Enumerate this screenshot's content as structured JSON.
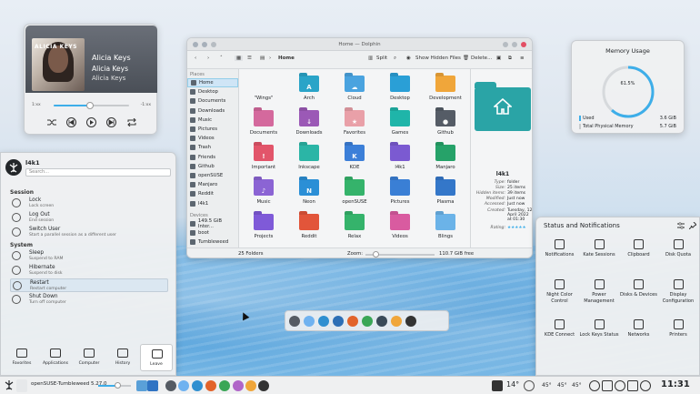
{
  "media": {
    "cover_text": "ALICIA KEYS",
    "title": "Alicia Keys",
    "artist": "Alicia Keys",
    "album": "Alicia Keys",
    "time_elapsed": "1:xx",
    "time_remaining": "-1:xx",
    "progress_fraction": 0.48
  },
  "dolphin": {
    "window_title": "Home — Dolphin",
    "breadcrumb": "Home",
    "toolbar": {
      "split": "Split",
      "show_hidden": "Show Hidden Files",
      "delete": "Delete..."
    },
    "places_header": "Places",
    "places": [
      "Home",
      "Desktop",
      "Documents",
      "Downloads",
      "Music",
      "Pictures",
      "Videos",
      "Trash",
      "Friends",
      "Github",
      "openSUSE",
      "Manjaro",
      "Reddit",
      "l4k1"
    ],
    "devices_header": "Devices",
    "devices": [
      "149.5 GiB Inter...",
      "boot",
      "Tumbleweed"
    ],
    "folders": [
      {
        "name": "\"Wings\"",
        "color": "#ffffff",
        "glyph": ""
      },
      {
        "name": "Arch",
        "color": "#2aa4c8",
        "glyph": "A"
      },
      {
        "name": "Cloud",
        "color": "#4aa3df",
        "glyph": "☁"
      },
      {
        "name": "Desktop",
        "color": "#2a9fd6",
        "glyph": ""
      },
      {
        "name": "Development",
        "color": "#f0a63a",
        "glyph": ""
      },
      {
        "name": "Documents",
        "color": "#d4699d",
        "glyph": ""
      },
      {
        "name": "Downloads",
        "color": "#9b59b6",
        "glyph": "↓"
      },
      {
        "name": "Favorites",
        "color": "#e9a0a8",
        "glyph": "★"
      },
      {
        "name": "Games",
        "color": "#1fb5a9",
        "glyph": ""
      },
      {
        "name": "Github",
        "color": "#555c66",
        "glyph": "●"
      },
      {
        "name": "Important",
        "color": "#e2556a",
        "glyph": "!"
      },
      {
        "name": "Inkscape",
        "color": "#2bb5a6",
        "glyph": ""
      },
      {
        "name": "KDE",
        "color": "#3c7fd8",
        "glyph": "K"
      },
      {
        "name": "l4k1",
        "color": "#7b5ad1",
        "glyph": ""
      },
      {
        "name": "Manjaro",
        "color": "#26a269",
        "glyph": ""
      },
      {
        "name": "Music",
        "color": "#8b64d4",
        "glyph": "♪"
      },
      {
        "name": "Neon",
        "color": "#2b8fd6",
        "glyph": "N"
      },
      {
        "name": "openSUSE",
        "color": "#35b36b",
        "glyph": ""
      },
      {
        "name": "Pictures",
        "color": "#3a7fd5",
        "glyph": ""
      },
      {
        "name": "Plasma",
        "color": "#3477c9",
        "glyph": ""
      },
      {
        "name": "Projects",
        "color": "#7f5ad8",
        "glyph": ""
      },
      {
        "name": "Reddit",
        "color": "#e2553a",
        "glyph": ""
      },
      {
        "name": "Relax",
        "color": "#35b36b",
        "glyph": ""
      },
      {
        "name": "Videos",
        "color": "#d95ba0",
        "glyph": ""
      },
      {
        "name": "Blings",
        "color": "#6bb3e8",
        "glyph": ""
      }
    ],
    "info": {
      "name": "l4k1",
      "fields": [
        {
          "k": "Type:",
          "v": "folder"
        },
        {
          "k": "Size:",
          "v": "25 items"
        },
        {
          "k": "Hidden items:",
          "v": "39 items"
        },
        {
          "k": "Modified:",
          "v": "Just now"
        },
        {
          "k": "Accessed:",
          "v": "Just now"
        },
        {
          "k": "Created:",
          "v": "Tuesday, 12 April 2022 at 01:30"
        },
        {
          "k": "Rating:",
          "v": "★★★★★"
        }
      ]
    },
    "status_left": "25 Folders",
    "zoom_label": "Zoom:",
    "free_space": "110.7 GiB free"
  },
  "memory": {
    "title": "Memory Usage",
    "percent_text": "61.5%",
    "percent": 61.5,
    "used_label": "Used",
    "used_value": "3.6 GiB",
    "total_label": "Total Physical Memory",
    "total_value": "5.7 GiB"
  },
  "launcher": {
    "username": "l4k1",
    "search_placeholder": "Search...",
    "session_header": "Session",
    "system_header": "System",
    "session_items": [
      {
        "a": "Lock",
        "b": "Lock screen"
      },
      {
        "a": "Log Out",
        "b": "End session"
      },
      {
        "a": "Switch User",
        "b": "Start a parallel session as a different user"
      }
    ],
    "system_items": [
      {
        "a": "Sleep",
        "b": "Suspend to RAM"
      },
      {
        "a": "Hibernate",
        "b": "Suspend to disk"
      },
      {
        "a": "Restart",
        "b": "Restart computer"
      },
      {
        "a": "Shut Down",
        "b": "Turn off computer"
      }
    ],
    "tabs": [
      "Favorites",
      "Applications",
      "Computer",
      "History",
      "Leave"
    ]
  },
  "status": {
    "title": "Status and Notifications",
    "cells": [
      "Notifications",
      "Kate Sessions",
      "Clipboard",
      "Disk Quota",
      "Night Color Control",
      "Power Management",
      "Disks & Devices",
      "Display Configuration",
      "KDE Connect",
      "Lock Keys Status",
      "Networks",
      "Printers"
    ]
  },
  "taskbar": {
    "task_label": "openSUSE-Tumbleweed 5.27.0",
    "weather": "14°",
    "temp1": "45°",
    "temp2": "45°",
    "temp3": "45°",
    "clock": "11:31"
  },
  "colors": {
    "accent": "#3daee9",
    "folder_teal": "#2aa4a6",
    "close": "#e34f64"
  }
}
